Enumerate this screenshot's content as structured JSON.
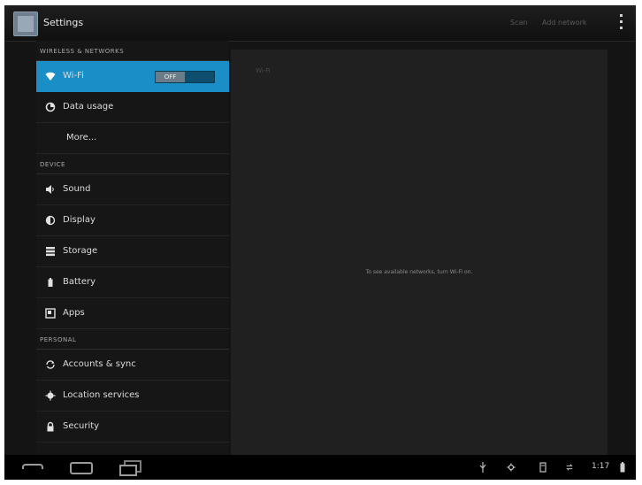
{
  "action_bar": {
    "title": "Settings",
    "action_1": "Scan",
    "action_2": "Add network"
  },
  "sidebar": {
    "section_wireless": "WIRELESS & NETWORKS",
    "wifi_label": "Wi-Fi",
    "wifi_toggle": "OFF",
    "data_usage_label": "Data usage",
    "more_label": "More...",
    "section_device": "DEVICE",
    "sound_label": "Sound",
    "display_label": "Display",
    "storage_label": "Storage",
    "battery_label": "Battery",
    "apps_label": "Apps",
    "section_personal": "PERSONAL",
    "accounts_label": "Accounts & sync",
    "location_label": "Location services",
    "security_label": "Security"
  },
  "content": {
    "header": "Wi-Fi",
    "message": "To see available networks, turn Wi-Fi on."
  },
  "statusbar": {
    "clock": "1:17"
  },
  "colors": {
    "accent": "#1a8ec7",
    "background": "#141414"
  }
}
